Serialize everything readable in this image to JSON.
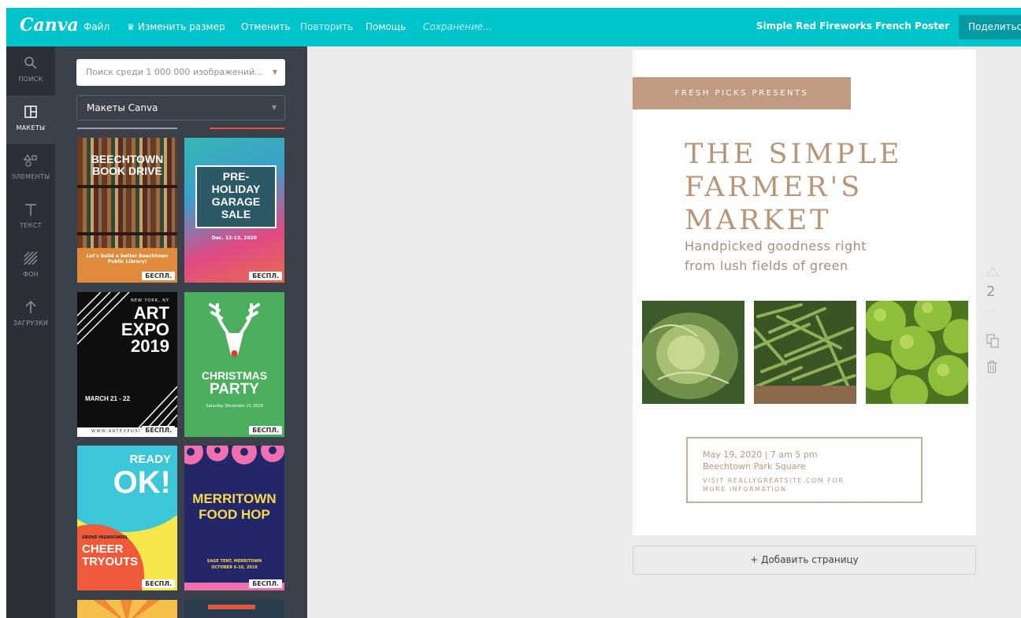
{
  "app": {
    "logo": "Canva"
  },
  "topbar": {
    "file": "Файл",
    "resize": "Изменить размер",
    "undo": "Отменить",
    "redo": "Повторить",
    "help": "Помощь",
    "status": "Сохранение...",
    "doc_title": "Simple Red Fireworks French Poster",
    "share": "Поделиться"
  },
  "sidebar": {
    "items": [
      {
        "label": "ПОИСК",
        "icon": "search-icon"
      },
      {
        "label": "МАКЕТЫ",
        "icon": "layout-icon"
      },
      {
        "label": "ЭЛЕМЕНТЫ",
        "icon": "shapes-icon"
      },
      {
        "label": "ТЕКСТ",
        "icon": "text-icon"
      },
      {
        "label": "ФОН",
        "icon": "background-icon"
      },
      {
        "label": "ЗАГРУЗКИ",
        "icon": "upload-icon"
      }
    ]
  },
  "panel": {
    "search_placeholder": "Поиск среди 1 000 000 изображений...",
    "filter": "Макеты Canva",
    "badge": "БЕСПЛ.",
    "templates": [
      {
        "lines": [
          "BEECHTOWN",
          "BOOK DRIVE"
        ],
        "small": "Let's build a better Beechtown Public Library!"
      },
      {
        "lines": [
          "PRE-",
          "HOLIDAY",
          "GARAGE",
          "SALE"
        ],
        "small": "Dec. 12-13, 2020"
      },
      {
        "lines": [
          "ART",
          "EXPO",
          "2019"
        ],
        "top": "NEW YORK, NY",
        "date": "MARCH 21 - 22",
        "url": "WWW.ARTEXPOSITE.COM"
      },
      {
        "lines": [
          "CHRISTMAS",
          "PARTY"
        ],
        "small": "Saturday December 21 2019"
      },
      {
        "lines": [
          "READY",
          "OK!"
        ],
        "sub": [
          "CHEER",
          "TRYOUTS"
        ],
        "school": "GROVE HIGHSCHOOL"
      },
      {
        "lines": [
          "MERRITOWN",
          "FOOD HOP"
        ],
        "small": "SAGE TENT, MERRITOWN",
        "date": "OCTOBER 6-10, 2019"
      }
    ]
  },
  "poster": {
    "tag": "FRESH PICKS PRESENTS",
    "headline": [
      "THE SIMPLE",
      "FARMER'S",
      "MARKET"
    ],
    "subline": [
      "Handpicked goodness right",
      "from lush fields of green"
    ],
    "date_time": "May 19, 2020 | 7 am   5 pm",
    "place": "Beechtown Park Square",
    "visit": [
      "VISIT REALLYGREATSITE.COM FOR",
      "MORE INFORMATION"
    ]
  },
  "canvas": {
    "add_page": "+ Добавить страницу",
    "page_number": "2"
  },
  "colors": {
    "accent": "#00c4cc",
    "rail": "#2b3038",
    "panel": "#3b414b",
    "poster_tan": "#c09a81"
  }
}
